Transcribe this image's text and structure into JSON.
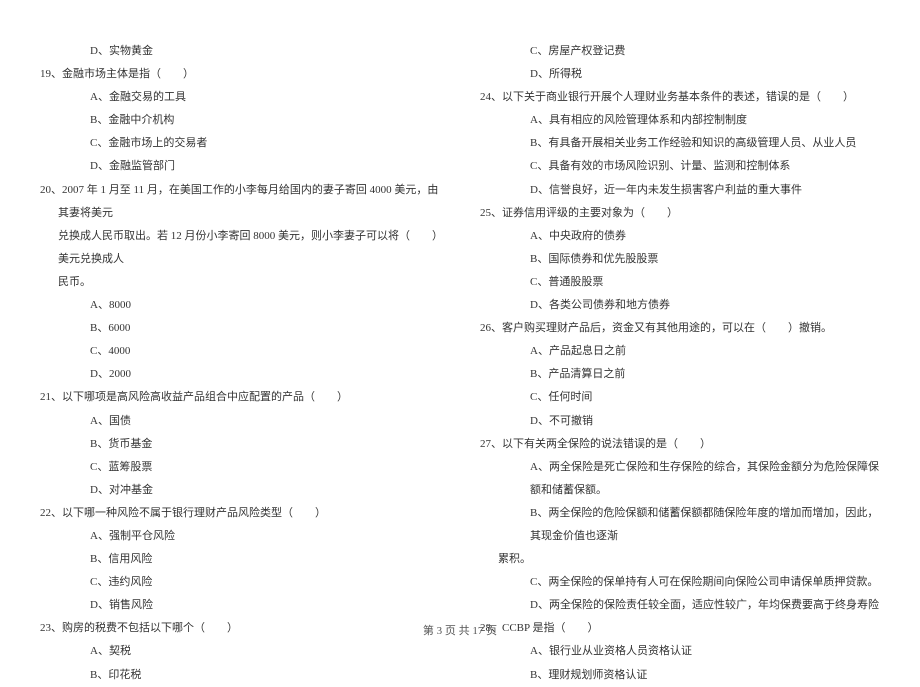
{
  "left_col": {
    "pre_opt_d": "D、实物黄金",
    "q19": {
      "stem": "19、金融市场主体是指（　　）",
      "a": "A、金融交易的工具",
      "b": "B、金融中介机构",
      "c": "C、金融市场上的交易者",
      "d": "D、金融监管部门"
    },
    "q20": {
      "stem": "20、2007 年 1 月至 11 月，在美国工作的小李每月给国内的妻子寄回 4000 美元，由其妻将美元",
      "stem_cont1": "兑换成人民币取出。若 12 月份小李寄回 8000 美元，则小李妻子可以将（　　）美元兑换成人",
      "stem_cont2": "民币。",
      "a": "A、8000",
      "b": "B、6000",
      "c": "C、4000",
      "d": "D、2000"
    },
    "q21": {
      "stem": "21、以下哪项是高风险高收益产品组合中应配置的产品（　　）",
      "a": "A、国债",
      "b": "B、货币基金",
      "c": "C、蓝筹股票",
      "d": "D、对冲基金"
    },
    "q22": {
      "stem": "22、以下哪一种风险不属于银行理财产品风险类型（　　）",
      "a": "A、强制平仓风险",
      "b": "B、信用风险",
      "c": "C、违约风险",
      "d": "D、销售风险"
    },
    "q23": {
      "stem": "23、购房的税费不包括以下哪个（　　）",
      "a": "A、契税",
      "b": "B、印花税"
    }
  },
  "right_col": {
    "q23_cont": {
      "c": "C、房屋产权登记费",
      "d": "D、所得税"
    },
    "q24": {
      "stem": "24、以下关于商业银行开展个人理财业务基本条件的表述，错误的是（　　）",
      "a": "A、具有相应的风险管理体系和内部控制制度",
      "b": "B、有具备开展相关业务工作经验和知识的高级管理人员、从业人员",
      "c": "C、具备有效的市场风险识别、计量、监测和控制体系",
      "d": "D、信誉良好，近一年内未发生损害客户利益的重大事件"
    },
    "q25": {
      "stem": "25、证券信用评级的主要对象为（　　）",
      "a": "A、中央政府的债券",
      "b": "B、国际债券和优先股股票",
      "c": "C、普通股股票",
      "d": "D、各类公司债券和地方债券"
    },
    "q26": {
      "stem": "26、客户购买理财产品后，资金又有其他用途的，可以在（　　）撤销。",
      "a": "A、产品起息日之前",
      "b": "B、产品清算日之前",
      "c": "C、任何时间",
      "d": "D、不可撤销"
    },
    "q27": {
      "stem": "27、以下有关两全保险的说法错误的是（　　）",
      "a": "A、两全保险是死亡保险和生存保险的综合，其保险金额分为危险保障保额和储蓄保额。",
      "b": "B、两全保险的危险保额和储蓄保额都随保险年度的增加而增加，因此，其现金价值也逐渐",
      "b_cont": "累积。",
      "c": "C、两全保险的保单持有人可在保险期间向保险公司申请保单质押贷款。",
      "d": "D、两全保险的保险责任较全面，适应性较广，年均保费要高于终身寿险"
    },
    "q28": {
      "stem": "28、CCBP 是指（　　）",
      "a": "A、银行业从业资格人员资格认证",
      "b": "B、理财规划师资格认证"
    }
  },
  "footer": "第 3 页 共 17 页"
}
